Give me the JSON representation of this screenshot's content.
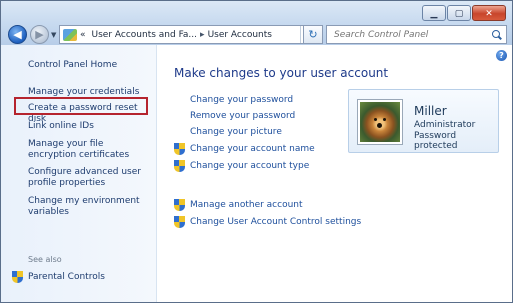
{
  "window": {
    "minimize": "▁",
    "maximize": "▢",
    "close": "✕"
  },
  "nav": {
    "back": "◀",
    "forward": "▶",
    "dropdown": "▼"
  },
  "address": {
    "prefix": "«",
    "crumbs": [
      "User Accounts and Fa...",
      "User Accounts"
    ],
    "separator": "▸",
    "dropdown": "▼",
    "refresh": "↻"
  },
  "search": {
    "placeholder": "Search Control Panel"
  },
  "sidebar": {
    "home": "Control Panel Home",
    "items": [
      "Manage your credentials",
      "Create a password reset disk",
      "Link online IDs",
      "Manage your file encryption certificates",
      "Configure advanced user profile properties",
      "Change my environment variables"
    ],
    "see_also": "See also",
    "see_also_items": [
      "Parental Controls"
    ]
  },
  "main": {
    "help": "?",
    "title": "Make changes to your user account",
    "tasks": [
      {
        "label": "Change your password",
        "shield": false
      },
      {
        "label": "Remove your password",
        "shield": false
      },
      {
        "label": "Change your picture",
        "shield": false
      },
      {
        "label": "Change your account name",
        "shield": true
      },
      {
        "label": "Change your account type",
        "shield": true
      }
    ],
    "more_tasks": [
      {
        "label": "Manage another account",
        "shield": true
      },
      {
        "label": "Change User Account Control settings",
        "shield": true
      }
    ]
  },
  "user": {
    "name": "Miller",
    "role": "Administrator",
    "status": "Password protected"
  },
  "colors": {
    "link": "#1e4f9c",
    "title": "#1e3a8a",
    "highlight": "#b5242e"
  }
}
